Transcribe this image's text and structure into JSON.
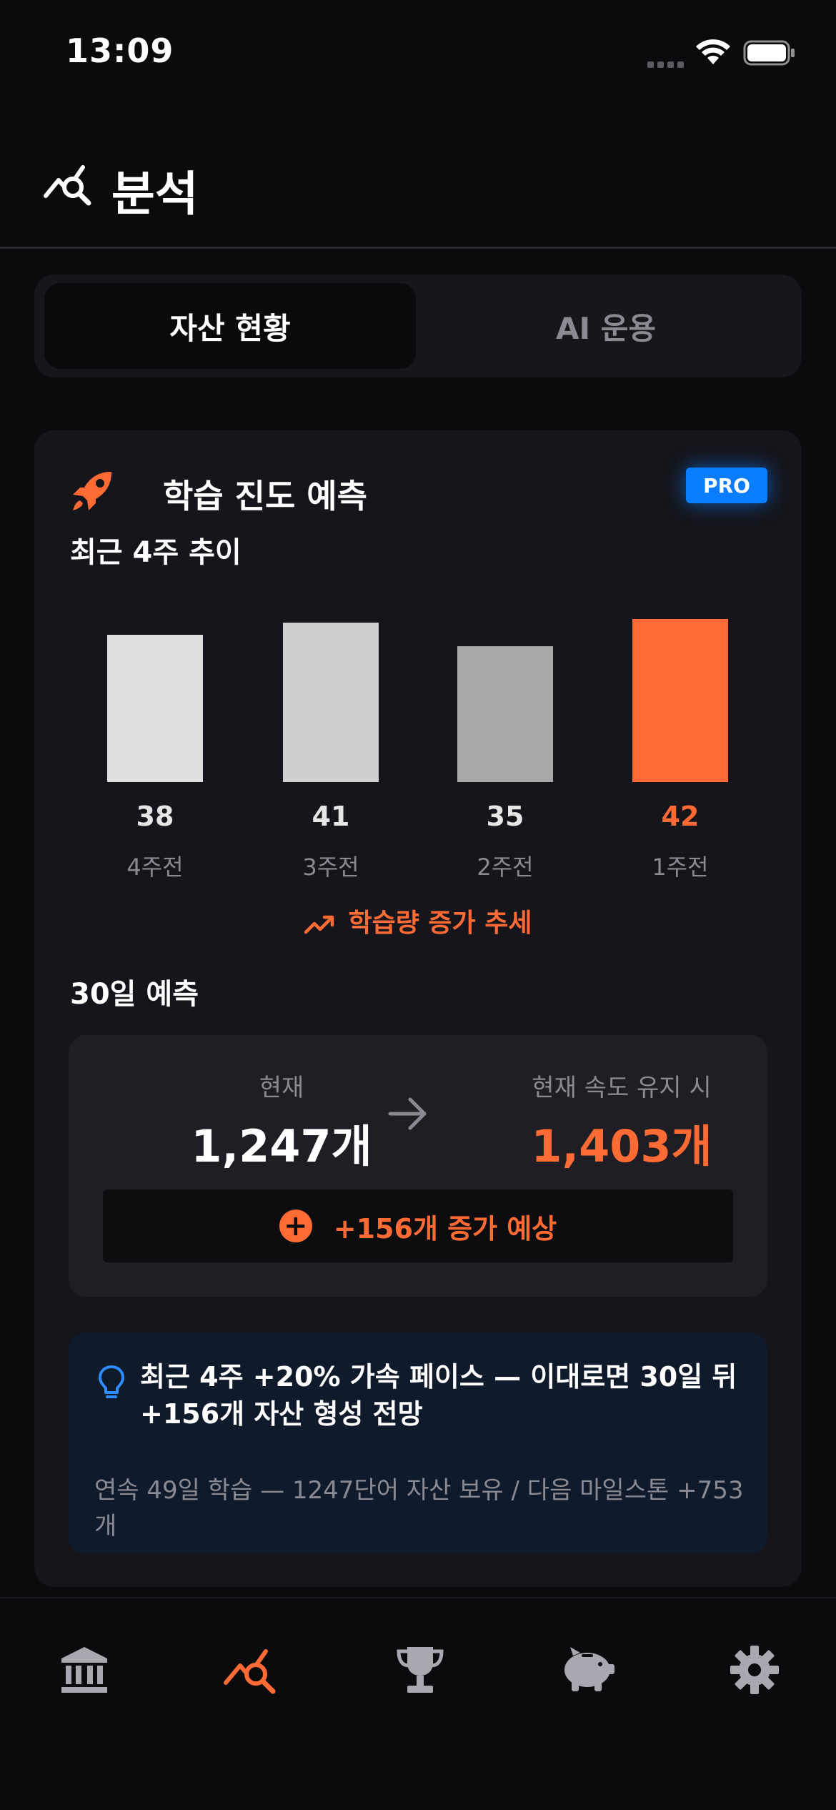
{
  "status_bar": {
    "time": "13:09"
  },
  "header": {
    "title": "분석"
  },
  "tabs": [
    {
      "label": "자산 현황",
      "active": true
    },
    {
      "label": "AI 운용",
      "active": false
    }
  ],
  "card": {
    "title": "학습 진도 예측",
    "badge": "PRO",
    "subtitle": "최근 4주 추이",
    "trend_text": "학습량 증가 추세",
    "forecast_title": "30일 예측",
    "forecast": {
      "current_label": "현재",
      "current_value": "1,247개",
      "projected_label": "현재 속도 유지 시",
      "projected_value": "1,403개",
      "increase_text": "+156개 증가 예상"
    },
    "insight": {
      "main": "최근 4주 +20% 가속 페이스 — 이대로면 30일 뒤 +156개 자산 형성 전망",
      "sub": "연속 49일 학습 — 1247단어 자산 보유 / 다음 마일스톤 +753개"
    }
  },
  "chart_data": {
    "type": "bar",
    "categories": [
      "4주전",
      "3주전",
      "2주전",
      "1주전"
    ],
    "values": [
      38,
      41,
      35,
      42
    ],
    "title": "",
    "xlabel": "",
    "ylabel": "",
    "colors": [
      "#dedede",
      "#cfcfcf",
      "#a8a8a8",
      "#ff6b35"
    ],
    "highlight_index": 3
  },
  "nav": {
    "items": [
      {
        "icon": "bank-icon",
        "active": false
      },
      {
        "icon": "analytics-icon",
        "active": true
      },
      {
        "icon": "trophy-icon",
        "active": false
      },
      {
        "icon": "piggy-bank-icon",
        "active": false
      },
      {
        "icon": "gear-icon",
        "active": false
      }
    ]
  },
  "colors": {
    "accent": "#ff6b35",
    "pro_blue": "#0a7cff",
    "muted": "#8a8a92"
  }
}
